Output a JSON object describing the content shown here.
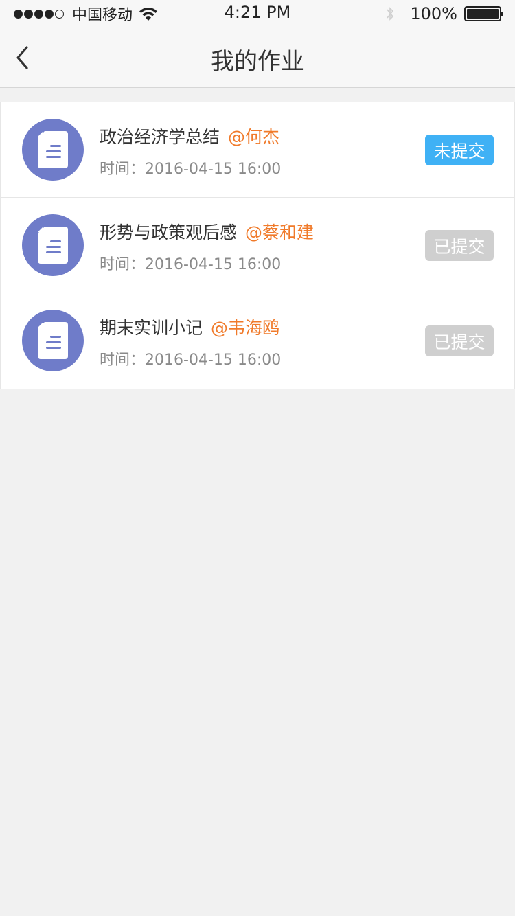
{
  "status_bar": {
    "carrier": "中国移动",
    "time": "4:21 PM",
    "battery_percent": "100%",
    "signal_bars_filled": 4,
    "signal_bars_total": 5
  },
  "nav": {
    "title": "我的作业",
    "back_icon": "chevron-left-icon"
  },
  "colors": {
    "avatar_bg": "#6f7cc9",
    "author": "#f07a2a",
    "badge_pending": "#3fb1f5",
    "badge_done": "#cfcfcf"
  },
  "assignments": [
    {
      "title": "政治经济学总结",
      "author": "@何杰",
      "time_label": "时间：",
      "time": "2016-04-15  16:00",
      "status": "未提交",
      "status_type": "pending"
    },
    {
      "title": "形势与政策观后感",
      "author": "@蔡和建",
      "time_label": "时间：",
      "time": "2016-04-15  16:00",
      "status": "已提交",
      "status_type": "done"
    },
    {
      "title": "期末实训小记",
      "author": "@韦海鸥",
      "time_label": "时间：",
      "time": "2016-04-15  16:00",
      "status": "已提交",
      "status_type": "done"
    }
  ]
}
